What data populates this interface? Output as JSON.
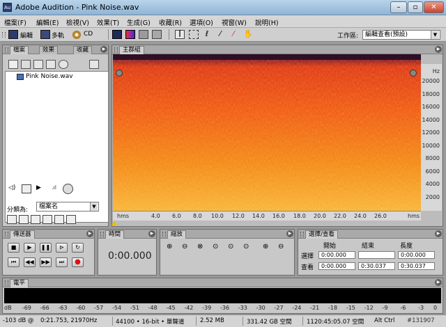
{
  "window": {
    "app_icon": "Au",
    "title": "Adobe Audition - Pink Noise.wav",
    "min_label": "–",
    "max_label": "▫",
    "close_label": "✕"
  },
  "menu": [
    "檔案(F)",
    "編輯(E)",
    "檢視(V)",
    "效果(T)",
    "生成(G)",
    "收藏(R)",
    "選項(O)",
    "視窗(W)",
    "說明(H)"
  ],
  "toolbar": {
    "edit_label": "編輯",
    "multitrack_label": "多軌",
    "cd_label": "CD",
    "workspace_label": "工作區:",
    "workspace_value": "編輯查看(預設)"
  },
  "files_panel": {
    "tabs": [
      "檔案",
      "效果",
      "收藏"
    ],
    "items": [
      "Pink Noise.wav"
    ],
    "sort_label": "分類為:",
    "sort_value": "檔案名"
  },
  "main_panel": {
    "tab": "主群組",
    "time_ticks": [
      "hms",
      "4.0",
      "6.0",
      "8.0",
      "10.0",
      "12.0",
      "14.0",
      "16.0",
      "18.0",
      "20.0",
      "22.0",
      "24.0",
      "26.0",
      "hms"
    ],
    "freq_unit": "Hz",
    "freq_ticks": [
      "20000",
      "18000",
      "16000",
      "14000",
      "12000",
      "10000",
      "8000",
      "6000",
      "4000",
      "2000"
    ]
  },
  "transport": {
    "tab": "傳送器"
  },
  "time_panel": {
    "tab": "時間",
    "display": "0:00.000"
  },
  "zoom_panel": {
    "tab": "縮放"
  },
  "selection_panel": {
    "tab": "選擇/查看",
    "col_start": "開始",
    "col_end": "結束",
    "col_length": "長度",
    "row_select": "選擇",
    "row_view": "查看",
    "select_start": "0:00.000",
    "select_end": "",
    "select_length": "0:00.000",
    "view_start": "0:00.000",
    "view_end": "0:30.037",
    "view_length": "0:30.037"
  },
  "level_panel": {
    "tab": "電平",
    "scale": [
      "dB",
      "-69",
      "-66",
      "-63",
      "-60",
      "-57",
      "-54",
      "-51",
      "-48",
      "-45",
      "-42",
      "-39",
      "-36",
      "-33",
      "-30",
      "-27",
      "-24",
      "-21",
      "-18",
      "-15",
      "-12",
      "-9",
      "-6",
      "-3",
      "0"
    ]
  },
  "status_bar": {
    "level": "-103 dB @",
    "position": "0:21.753, 21970Hz",
    "format": "44100 • 16-bit • 單聲道",
    "size": "2.52 MB",
    "free_space": "331.42 GB 空間",
    "free_time": "1120:45:05.07 空間",
    "ctrl": "Alt Ctrl",
    "id": "#131907"
  }
}
